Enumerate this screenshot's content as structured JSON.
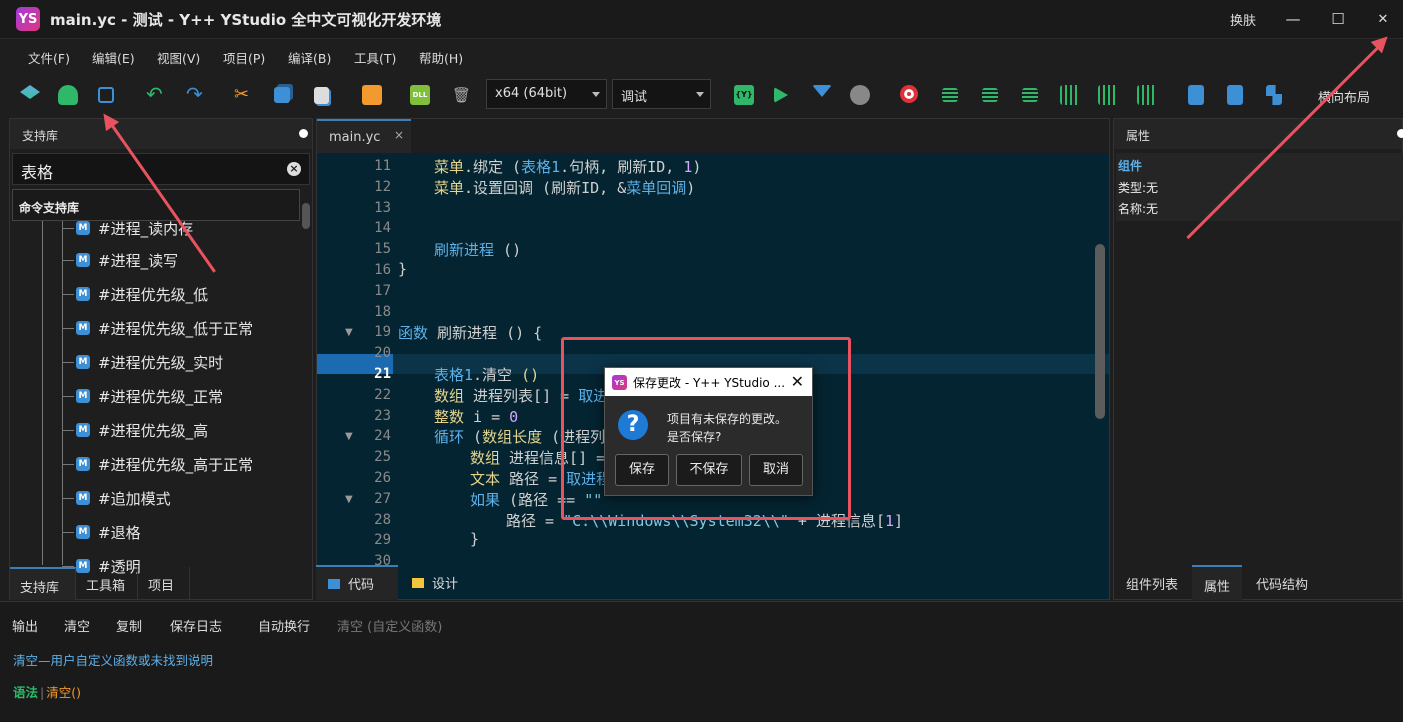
{
  "window": {
    "title": "main.yc - 测试 - Y++ YStudio 全中文可视化开发环境",
    "logo": "YS",
    "skin_label": "换肤",
    "minimize": "—",
    "maximize": "☐",
    "close": "✕"
  },
  "menu": [
    "文件(F)",
    "编辑(E)",
    "视图(V)",
    "项目(P)",
    "编译(B)",
    "工具(T)",
    "帮助(H)"
  ],
  "toolbar": {
    "platform": "x64 (64bit)",
    "mode": "调试",
    "layout_label": "横向布局",
    "dll_label": "DLL",
    "colors": {
      "green": "#2fb86a",
      "blue": "#3d8fd6",
      "red": "#e0303a",
      "orange": "#f29a2e"
    }
  },
  "left": {
    "header": "支持库",
    "search_value": "表格",
    "clear": "×",
    "section": "命令支持库",
    "badge": "M",
    "items": [
      "#进程_读内存",
      "#进程_读写",
      "#进程优先级_低",
      "#进程优先级_低于正常",
      "#进程优先级_实时",
      "#进程优先级_正常",
      "#进程优先级_高",
      "#进程优先级_高于正常",
      "#追加模式",
      "#退格",
      "#透明"
    ],
    "tabs": [
      "支持库",
      "工具箱",
      "项目"
    ]
  },
  "editor": {
    "file_tab": "main.yc",
    "tab_close": "×",
    "bottom_tabs": [
      "代码",
      "设计"
    ],
    "lines": [
      {
        "n": "11",
        "indent": 1,
        "parts": [
          [
            "菜单.",
            "fn"
          ],
          [
            "绑定 (",
            "t"
          ],
          [
            "表格1",
            "kw"
          ],
          [
            ".句柄, 刷新ID, ",
            "t"
          ],
          [
            "1",
            "num"
          ],
          [
            ")",
            "t"
          ]
        ]
      },
      {
        "n": "12",
        "indent": 1,
        "parts": [
          [
            "菜单.",
            "fn"
          ],
          [
            "设置回调 (刷新ID, &",
            "t"
          ],
          [
            "菜单回调",
            "kw"
          ],
          [
            ")",
            "t"
          ]
        ]
      },
      {
        "n": "13",
        "indent": 0,
        "parts": []
      },
      {
        "n": "14",
        "indent": 0,
        "parts": []
      },
      {
        "n": "15",
        "indent": 1,
        "parts": [
          [
            "刷新进程",
            "kw"
          ],
          [
            " ()",
            "t"
          ]
        ]
      },
      {
        "n": "16",
        "indent": 0,
        "parts": [
          [
            "}",
            "t"
          ]
        ]
      },
      {
        "n": "17",
        "indent": 0,
        "parts": []
      },
      {
        "n": "18",
        "indent": 0,
        "parts": []
      },
      {
        "n": "19",
        "indent": 0,
        "fold": true,
        "parts": [
          [
            "函数",
            "kw"
          ],
          [
            " 刷新进程 () {",
            "t"
          ]
        ]
      },
      {
        "n": "20",
        "indent": 0,
        "parts": []
      },
      {
        "n": "21",
        "indent": 1,
        "parts": [
          [
            "表格1",
            "kw"
          ],
          [
            ".清空 ",
            "t"
          ],
          [
            "()",
            "fn"
          ]
        ]
      },
      {
        "n": "22",
        "indent": 1,
        "parts": [
          [
            "数组",
            "fn"
          ],
          [
            " 进程列表[] = ",
            "t"
          ],
          [
            "取进",
            "kw"
          ]
        ]
      },
      {
        "n": "23",
        "indent": 1,
        "parts": [
          [
            "整数",
            "fn"
          ],
          [
            " i = ",
            "t"
          ],
          [
            "0",
            "num"
          ]
        ]
      },
      {
        "n": "24",
        "indent": 1,
        "fold": true,
        "parts": [
          [
            "循环",
            "kw"
          ],
          [
            " (",
            "t"
          ],
          [
            "数组长度",
            "fn"
          ],
          [
            " (进程列",
            "t"
          ]
        ]
      },
      {
        "n": "25",
        "indent": 2,
        "parts": [
          [
            "数组",
            "fn"
          ],
          [
            " 进程信息[] = ",
            "t"
          ],
          [
            "                ",
            "t"
          ],
          [
            "\"|\"",
            "str"
          ],
          [
            ")",
            "t"
          ]
        ]
      },
      {
        "n": "26",
        "indent": 2,
        "parts": [
          [
            "文本",
            "fn"
          ],
          [
            " 路径 = ",
            "t"
          ],
          [
            "取进程",
            "kw"
          ],
          [
            "                ",
            "t"
          ],
          [
            "]))",
            "t"
          ]
        ]
      },
      {
        "n": "27",
        "indent": 2,
        "fold": true,
        "parts": [
          [
            "如果",
            "kw"
          ],
          [
            " (路径 == ",
            "t"
          ],
          [
            "\"\"",
            "str"
          ]
        ]
      },
      {
        "n": "28",
        "indent": 3,
        "parts": [
          [
            "路径 = ",
            "t"
          ],
          [
            "\"C:\\\\Windows\\\\System32\\\\\"",
            "str"
          ],
          [
            " + 进程信息[",
            "t"
          ],
          [
            "1",
            "num"
          ],
          [
            "]",
            "t"
          ]
        ]
      },
      {
        "n": "29",
        "indent": 2,
        "parts": [
          [
            "}",
            "t"
          ]
        ]
      },
      {
        "n": "30",
        "indent": 0,
        "parts": []
      }
    ]
  },
  "right": {
    "header": "属性",
    "group": "组件",
    "type_label": "类型:无",
    "name_label": "名称:无",
    "tabs": [
      "组件列表",
      "属性",
      "代码结构"
    ]
  },
  "output": {
    "buttons": [
      "输出",
      "清空",
      "复制",
      "保存日志",
      "自动换行",
      "清空 (自定义函数)"
    ],
    "line1_keyword": "清空",
    "line1_text": "—用户自定义函数或未找到说明",
    "line2_keyword": "语法",
    "line2_sep": "|",
    "line2_text": "清空()"
  },
  "dialog": {
    "title": "保存更改 - Y++ YStudio ...",
    "icon": "YS",
    "close": "✕",
    "q": "?",
    "message1": "项目有未保存的更改。",
    "message2": "是否保存?",
    "buttons": [
      "保存",
      "不保存",
      "取消"
    ]
  }
}
